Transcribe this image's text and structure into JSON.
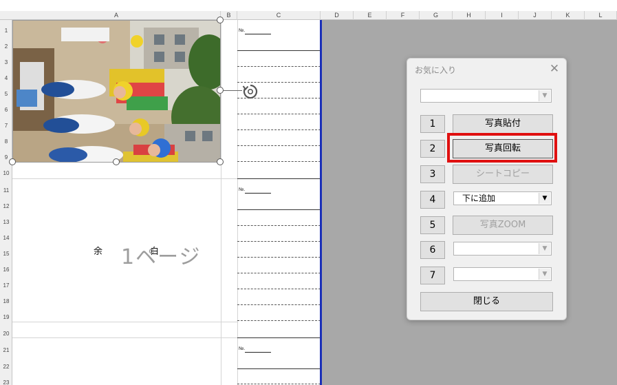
{
  "columns": [
    "A",
    "B",
    "C",
    "D",
    "E",
    "F",
    "G",
    "H",
    "I",
    "J",
    "K",
    "L"
  ],
  "rows": [
    "1",
    "2",
    "3",
    "4",
    "5",
    "6",
    "7",
    "8",
    "9",
    "10",
    "11",
    "12",
    "13",
    "14",
    "15",
    "16",
    "17",
    "18",
    "19",
    "20",
    "21",
    "22",
    "23"
  ],
  "sheet": {
    "no_label": "№.",
    "margin_text": "余　白",
    "page_text": "1ページ"
  },
  "dialog": {
    "title": "お気に入り",
    "close_glyph": "✕",
    "top_combo_value": "",
    "numbers": [
      "1",
      "2",
      "3",
      "4",
      "5",
      "6",
      "7"
    ],
    "button_1": "写真貼付",
    "button_2": "写真回転",
    "button_3": "シートコピー",
    "combo_4_value": "下に追加",
    "button_5": "写真ZOOM",
    "combo_6_value": "",
    "combo_7_value": "",
    "close_button": "閉じる"
  },
  "colors": {
    "highlight": "#e01010",
    "page_border": "#1a2fb8"
  },
  "icons": {
    "rotate_handle": "rotate-icon",
    "combo_arrow": "dropdown-arrow-icon"
  }
}
